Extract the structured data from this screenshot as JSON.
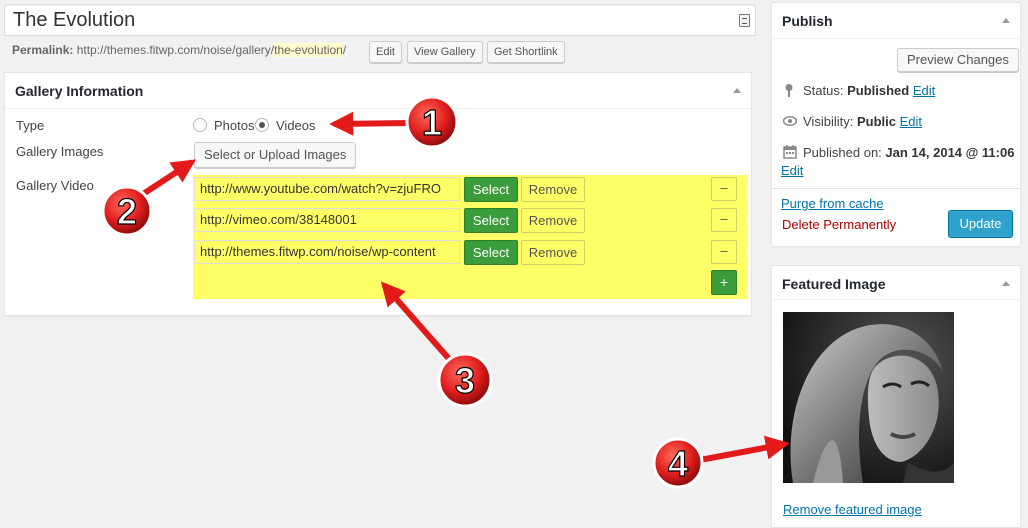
{
  "post": {
    "title": "The Evolution",
    "permalink_label": "Permalink:",
    "permalink_base": "http://themes.fitwp.com/noise/gallery/",
    "permalink_slug": "the-evolution",
    "permalink_tail": "/",
    "edit_label": "Edit",
    "view_label": "View Gallery",
    "shortlink_label": "Get Shortlink"
  },
  "gallery": {
    "heading": "Gallery Information",
    "type_label": "Type",
    "type_options": [
      "Photos",
      "Videos"
    ],
    "type_selected": "Videos",
    "images_label": "Gallery Images",
    "upload_button": "Select or Upload Images",
    "video_label": "Gallery Video",
    "videos": [
      "http://www.youtube.com/watch?v=zjuFRO",
      "http://vimeo.com/38148001",
      "http://themes.fitwp.com/noise/wp-content"
    ],
    "select_label": "Select",
    "remove_label": "Remove",
    "minus_label": "–",
    "plus_label": "+"
  },
  "publish": {
    "heading": "Publish",
    "preview_button": "Preview Changes",
    "status_label": "Status:",
    "status_value": "Published",
    "visibility_label": "Visibility:",
    "visibility_value": "Public",
    "published_label": "Published on:",
    "published_value": "Jan 14, 2014 @ 11:06",
    "edit_link": "Edit",
    "purge_link": "Purge from cache",
    "delete_link": "Delete Permanently",
    "update_button": "Update"
  },
  "featured": {
    "heading": "Featured Image",
    "remove_link": "Remove featured image"
  },
  "callouts": [
    "1",
    "2",
    "3",
    "4"
  ],
  "colors": {
    "accent": "#2ea2cc",
    "select_green": "#3b9c3b",
    "highlight_yellow": "#ffff66",
    "callout_red": "#e02020",
    "arrow_red": "#e31a1a"
  }
}
